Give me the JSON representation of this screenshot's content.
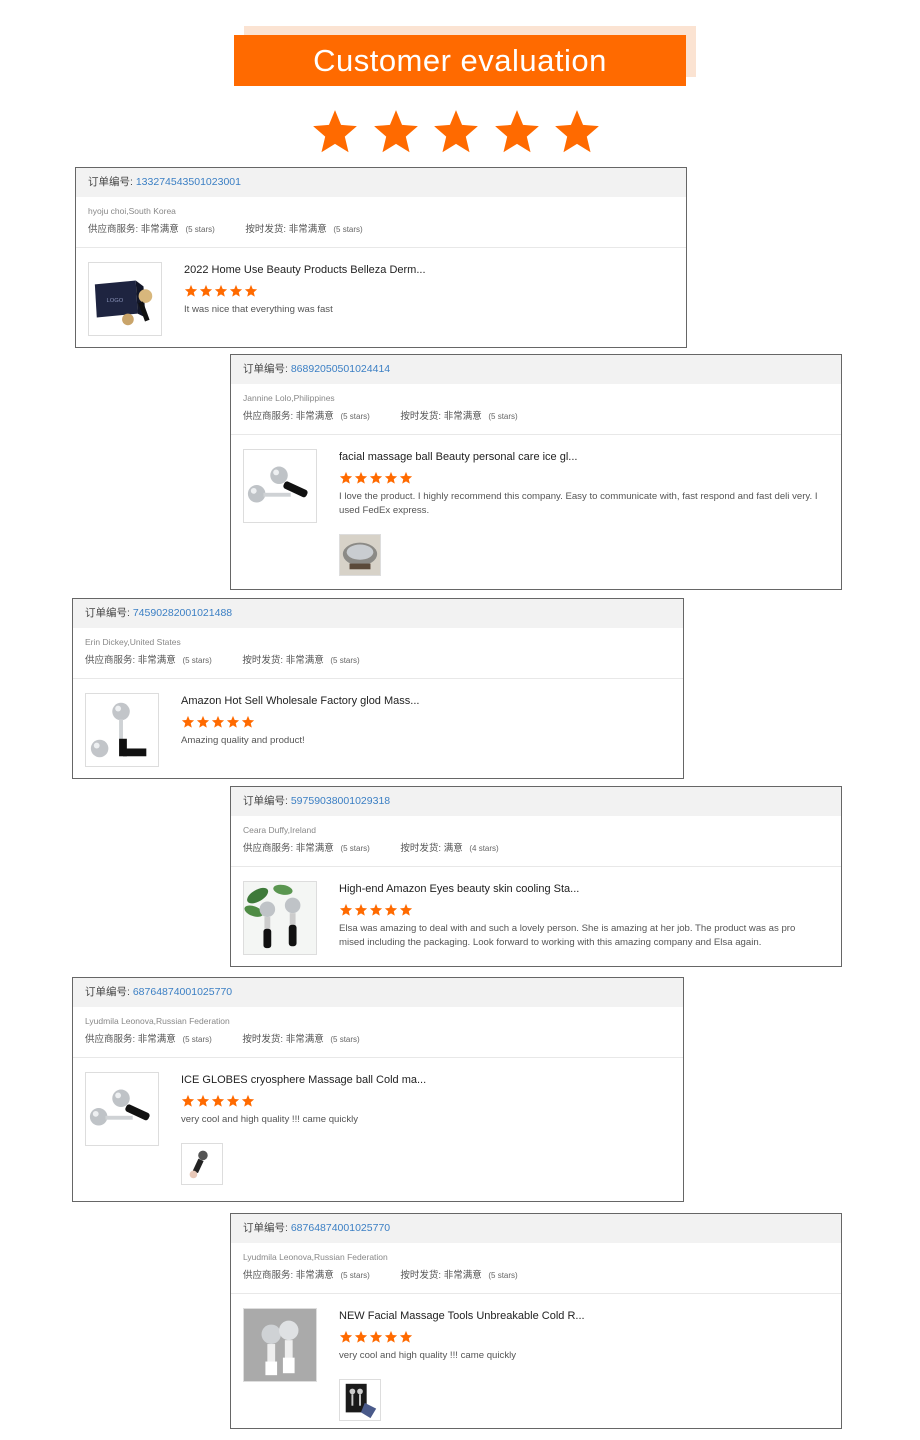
{
  "banner": {
    "title": "Customer evaluation",
    "star_count": 5,
    "color": "#ff6a00"
  },
  "labels": {
    "order_prefix": "订单编号: ",
    "supplier": "供应商服务:",
    "shipping": "按时发货:"
  },
  "reviews": [
    {
      "order": "133274543501023001",
      "buyer": "hyoju choi,South Korea",
      "supplier_rating": "非常满意",
      "supplier_stars": "(5 stars)",
      "shipping_rating": "非常满意",
      "shipping_stars": "(5 stars)",
      "product": "2022 Home Use Beauty Products Belleza Derm...",
      "stars": 5,
      "comment": "It was nice that everything was fast",
      "thumb": "logo-box-icon",
      "has_photo": false
    },
    {
      "order": "86892050501024414",
      "buyer": "Jannine Lolo,Philippines",
      "supplier_rating": "非常满意",
      "supplier_stars": "(5 stars)",
      "shipping_rating": "非常满意",
      "shipping_stars": "(5 stars)",
      "product": "facial massage ball Beauty personal care ice gl...",
      "stars": 5,
      "comment": "I love the product. I highly recommend this company. Easy to communicate with, fast respond and fast deli very. I used FedEx express.",
      "thumb": "massage-ball-icon",
      "has_photo": true,
      "photo": "package-photo-icon"
    },
    {
      "order": "74590282001021488",
      "buyer": "Erin Dickey,United States",
      "supplier_rating": "非常满意",
      "supplier_stars": "(5 stars)",
      "shipping_rating": "非常满意",
      "shipping_stars": "(5 stars)",
      "product": "Amazon Hot Sell Wholesale Factory glod Mass...",
      "stars": 5,
      "comment": "Amazing quality and product!",
      "thumb": "massage-ball-pair-icon",
      "has_photo": false
    },
    {
      "order": "59759038001029318",
      "buyer": "Ceara Duffy,Ireland",
      "supplier_rating": "非常满意",
      "supplier_stars": "(5 stars)",
      "shipping_rating": "满意",
      "shipping_stars": "(4 stars)",
      "product": "High-end Amazon Eyes beauty skin cooling Sta...",
      "stars": 5,
      "comment": "Elsa was amazing to deal with and such a lovely person. She is amazing at her job. The product was as pro mised including the packaging. Look forward to working with this amazing company and Elsa again.",
      "thumb": "massage-balls-plant-icon",
      "has_photo": false
    },
    {
      "order": "68764874001025770",
      "buyer": "Lyudmila Leonova,Russian Federation",
      "supplier_rating": "非常满意",
      "supplier_stars": "(5 stars)",
      "shipping_rating": "非常满意",
      "shipping_stars": "(5 stars)",
      "product": "ICE GLOBES cryosphere Massage ball Cold ma...",
      "stars": 5,
      "comment": "very cool and high quality !!! came quickly",
      "thumb": "massage-ball-icon",
      "has_photo": true,
      "photo": "hand-photo-icon"
    },
    {
      "order": "68764874001025770",
      "buyer": "Lyudmila Leonova,Russian Federation",
      "supplier_rating": "非常满意",
      "supplier_stars": "(5 stars)",
      "shipping_rating": "非常满意",
      "shipping_stars": "(5 stars)",
      "product": "NEW Facial Massage Tools Unbreakable Cold R...",
      "stars": 5,
      "comment": "very cool and high quality !!! came quickly",
      "thumb": "massage-balls-gray-icon",
      "has_photo": true,
      "photo": "gift-box-photo-icon"
    }
  ]
}
